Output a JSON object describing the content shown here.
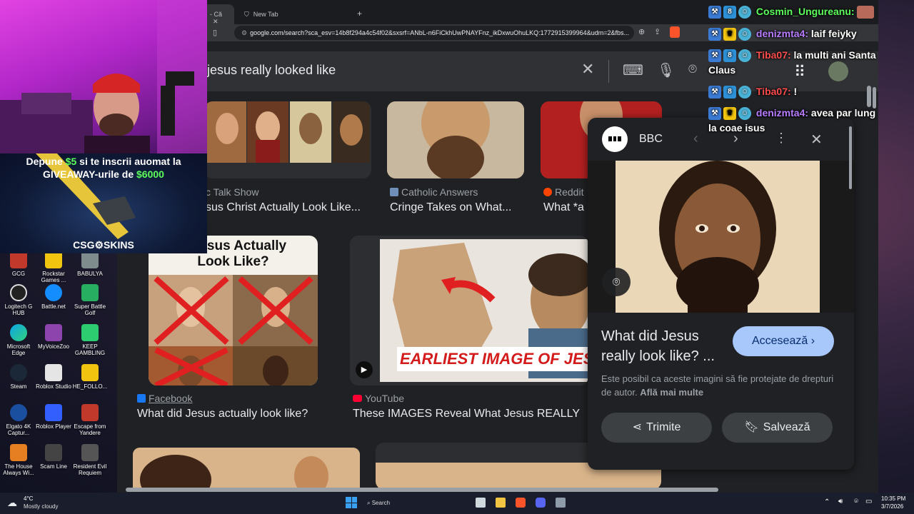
{
  "tabs": [
    {
      "label": "- Că"
    },
    {
      "label": "New Tab"
    }
  ],
  "address_bar": {
    "url": "google.com/search?sca_esv=14b8f294a4c54f02&sxsrf=ANbL-n6FiCkhUwPNAYFnz_ikDxwuOhuLKQ:1772915399964&udm=2&fbs..."
  },
  "search": {
    "query": "jesus really looked like"
  },
  "results_row1": [
    {
      "source": "c Talk Show",
      "title": "sus Christ Actually Look Like..."
    },
    {
      "source": "Catholic Answers",
      "title": "Cringe Takes on What..."
    },
    {
      "source": "Reddit",
      "title": "What *a"
    }
  ],
  "results_row2": [
    {
      "source": "Facebook",
      "title": "What did Jesus actually look like?",
      "thumb_text": "d Jesus Actually\nLook Like?"
    },
    {
      "source": "YouTube",
      "title": "These IMAGES Reveal What Jesus REALLY",
      "thumb_text": "EARLIEST IMAGE OF JES"
    }
  ],
  "panel": {
    "source": "BBC",
    "title": "What did Jesus really look like? ...",
    "visit_label": "Accesează",
    "copyright": "Este posibil ca aceste imagini să fie protejate de drepturi de autor.",
    "learn_more": "Află mai multe",
    "share_label": "Trimite",
    "save_label": "Salvează"
  },
  "chat": [
    {
      "user": "Cosmin_Ungureanu:",
      "color": "#5cff5c",
      "message": ""
    },
    {
      "user": "denizmta4:",
      "color": "#b77cff",
      "message": "laif feiyky"
    },
    {
      "user": "Tiba07:",
      "color": "#ff4d4d",
      "message": "la multi ani Santa"
    },
    {
      "user": "",
      "color": "#ffffff",
      "message": "Claus"
    },
    {
      "user": "Tiba07:",
      "color": "#ff4d4d",
      "message": "!"
    },
    {
      "user": "denizmta4:",
      "color": "#b77cff",
      "message": "avea par lung"
    },
    {
      "user": "",
      "color": "#ffffff",
      "message": "la coae isus"
    }
  ],
  "promo": {
    "line1_a": "Depune ",
    "line1_amount": "$5",
    "line1_b": " si te inscrii auomat la",
    "line2_a": "GIVEAWAY-urile de ",
    "line2_amount": "$6000",
    "brand": "CSG",
    "brand2": "SKINS"
  },
  "desktop_icons": [
    {
      "label": "GCG"
    },
    {
      "label": "Rockstar Games ..."
    },
    {
      "label": "BABULYA"
    },
    {
      "label": "Logitech G HUB"
    },
    {
      "label": "Battle.net"
    },
    {
      "label": "Super Battle Golf"
    },
    {
      "label": "Microsoft Edge"
    },
    {
      "label": "MyVoiceZoo"
    },
    {
      "label": "KEEP GAMBLING"
    },
    {
      "label": "Steam"
    },
    {
      "label": "Roblox Studio"
    },
    {
      "label": "HE_FOLLO..."
    },
    {
      "label": "Elgato 4K Captur..."
    },
    {
      "label": "Roblox Player"
    },
    {
      "label": "Escape from Yandere"
    },
    {
      "label": "The House Always Wi..."
    },
    {
      "label": "Scam Line"
    },
    {
      "label": "Resident Evil Requiem"
    }
  ],
  "taskbar": {
    "weather_temp": "4°C",
    "weather_desc": "Mostly cloudy",
    "search_label": "Search",
    "time": "10:35 PM",
    "date": "3/7/2026"
  },
  "colors": {
    "accent_blue": "#a8c7fa",
    "panel_bg": "#202124",
    "link_blue": "#8ab4f8"
  }
}
